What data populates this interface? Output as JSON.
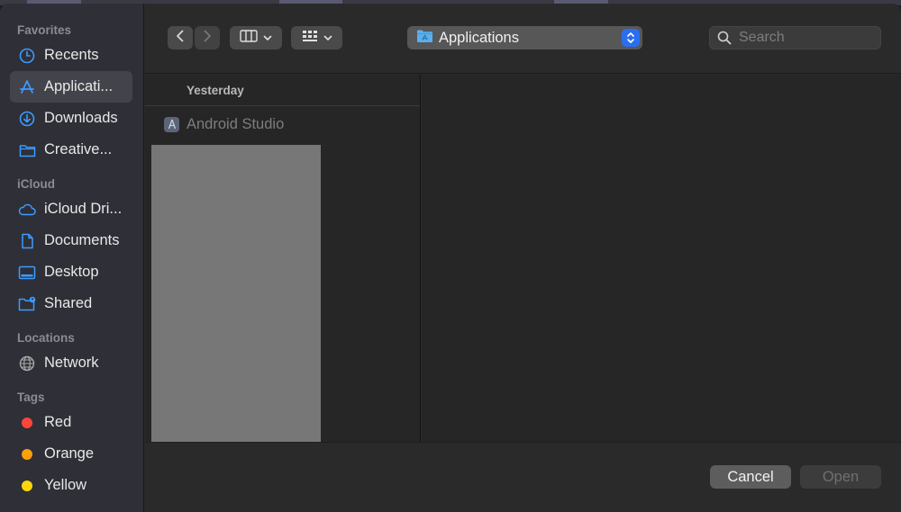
{
  "sidebar": {
    "favorites_title": "Favorites",
    "favorites": [
      {
        "label": "Recents",
        "icon": "clock-icon"
      },
      {
        "label": "Applicati...",
        "icon": "apps-icon"
      },
      {
        "label": "Downloads",
        "icon": "download-icon"
      },
      {
        "label": "Creative...",
        "icon": "folder-icon"
      }
    ],
    "icloud_title": "iCloud",
    "icloud": [
      {
        "label": "iCloud Dri...",
        "icon": "cloud-icon"
      },
      {
        "label": "Documents",
        "icon": "document-icon"
      },
      {
        "label": "Desktop",
        "icon": "desktop-icon"
      },
      {
        "label": "Shared",
        "icon": "shared-folder-icon"
      }
    ],
    "locations_title": "Locations",
    "locations": [
      {
        "label": "Network",
        "icon": "globe-icon"
      }
    ],
    "tags_title": "Tags",
    "tags": [
      {
        "label": "Red",
        "color": "#ff453a"
      },
      {
        "label": "Orange",
        "color": "#ff9f0a"
      },
      {
        "label": "Yellow",
        "color": "#ffd60a"
      }
    ]
  },
  "toolbar": {
    "location": "Applications",
    "search_placeholder": "Search"
  },
  "browser": {
    "group_header": "Yesterday",
    "items": [
      {
        "label": "Android Studio"
      }
    ]
  },
  "footer": {
    "cancel_label": "Cancel",
    "open_label": "Open"
  },
  "colors": {
    "accent": "#2a6ff0",
    "icon_blue": "#3b9cff"
  }
}
